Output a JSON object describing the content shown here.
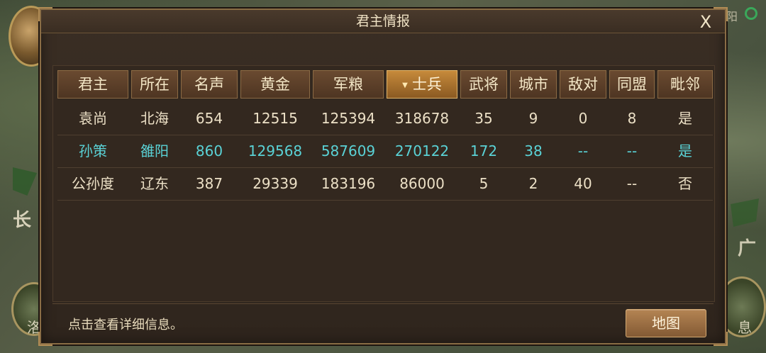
{
  "background_map": {
    "label_left": "长",
    "label_right": "广",
    "label_topright": "阳",
    "label_botleft": "洛",
    "label_botright": "息"
  },
  "dialog": {
    "title": "君主情报",
    "close_label": "X",
    "hint": "点击查看详细信息。",
    "map_button": "地图"
  },
  "table": {
    "headers": [
      "君主",
      "所在",
      "名声",
      "黄金",
      "军粮",
      "士兵",
      "武将",
      "城市",
      "敌对",
      "同盟",
      "毗邻"
    ],
    "sorted_column": "士兵",
    "rows": [
      [
        "袁尚",
        "北海",
        "654",
        "12515",
        "125394",
        "318678",
        "35",
        "9",
        "0",
        "8",
        "是"
      ],
      [
        "孙策",
        "雒阳",
        "860",
        "129568",
        "587609",
        "270122",
        "172",
        "38",
        "--",
        "--",
        "是"
      ],
      [
        "公孙度",
        "辽东",
        "387",
        "29339",
        "183196",
        "86000",
        "5",
        "2",
        "40",
        "--",
        "否"
      ]
    ],
    "highlighted_row": 1
  },
  "colors": {
    "panel_bg": "#2f251d",
    "header_bg": "#6a4a30",
    "active_header": "#c68a3b",
    "player_highlight": "#5ad2d6",
    "text": "#ece0c6"
  }
}
